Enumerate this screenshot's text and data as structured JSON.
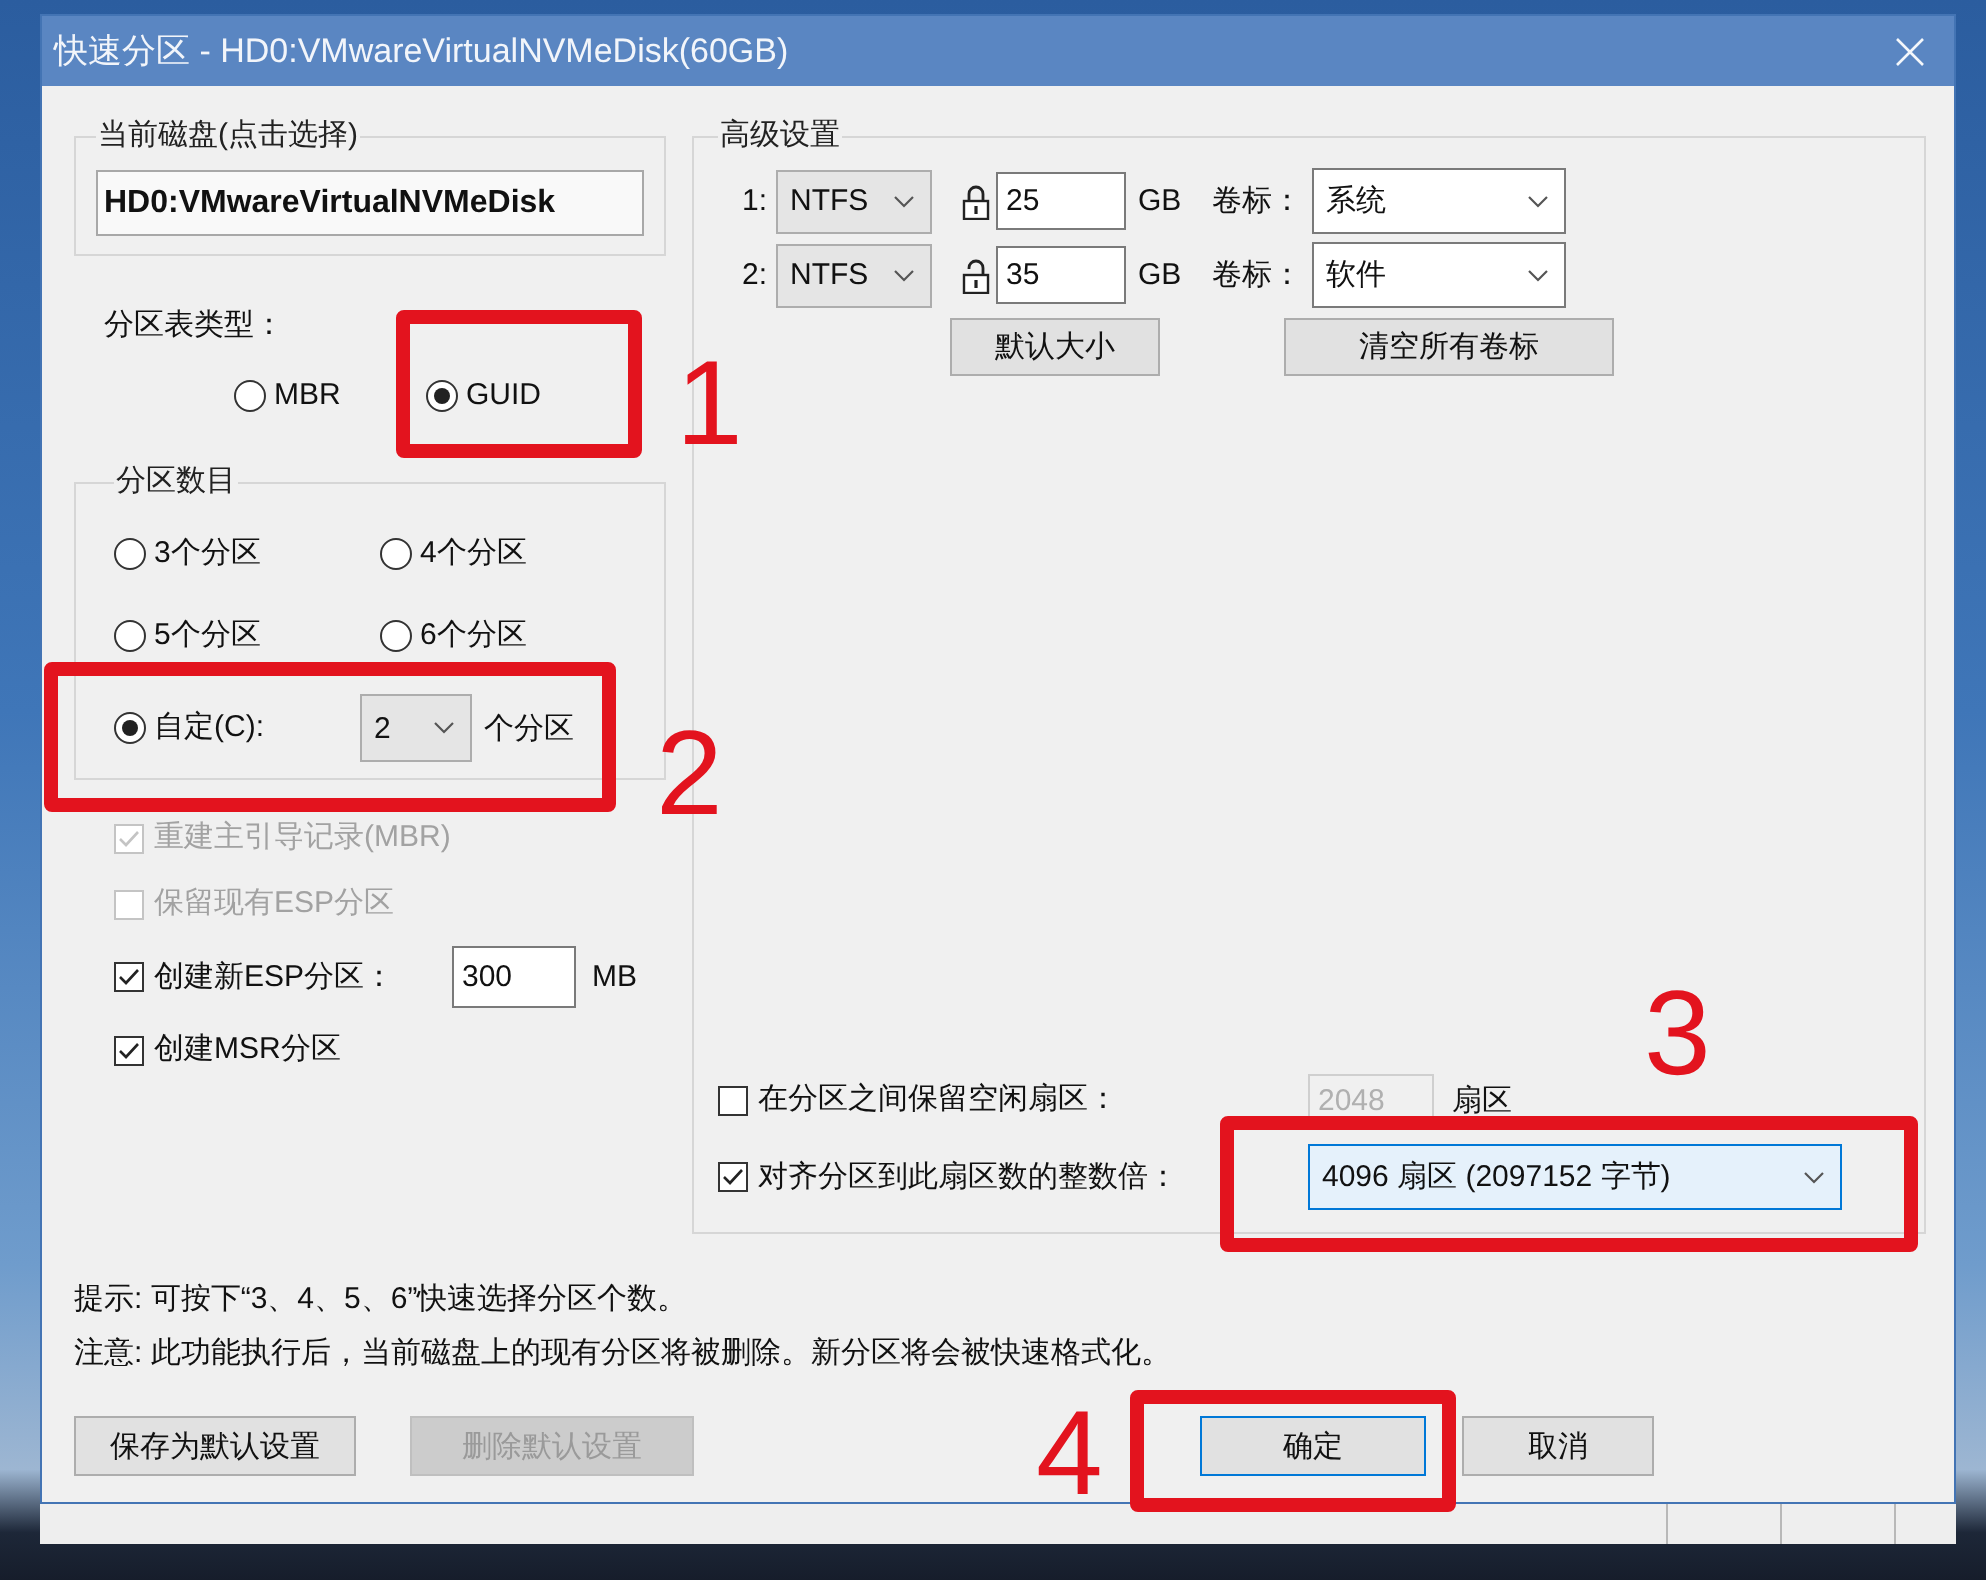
{
  "window": {
    "title": "快速分区 - HD0:VMwareVirtualNVMeDisk(60GB)"
  },
  "current_disk": {
    "label": "当前磁盘(点击选择)",
    "value": "HD0:VMwareVirtualNVMeDisk"
  },
  "partition_table": {
    "label": "分区表类型：",
    "options": [
      {
        "label": "MBR",
        "selected": false
      },
      {
        "label": "GUID",
        "selected": true
      }
    ]
  },
  "partition_count": {
    "label": "分区数目",
    "options": [
      {
        "kind": "radio",
        "label": "3个分区",
        "selected": false
      },
      {
        "kind": "radio",
        "label": "4个分区",
        "selected": false
      },
      {
        "kind": "radio",
        "label": "5个分区",
        "selected": false
      },
      {
        "kind": "radio",
        "label": "6个分区",
        "selected": false
      },
      {
        "kind": "radio_with_dropdown",
        "label": "自定(C):",
        "selected": true,
        "value": "2",
        "suffix": "个分区"
      }
    ]
  },
  "options": [
    {
      "kind": "checkbox",
      "label": "重建主引导记录(MBR)",
      "checked": true,
      "disabled": true
    },
    {
      "kind": "checkbox",
      "label": "保留现有ESP分区",
      "checked": false,
      "disabled": true
    },
    {
      "kind": "checkbox_with_field",
      "label": "创建新ESP分区：",
      "checked": true,
      "disabled": false,
      "value": "300",
      "unit": "MB"
    },
    {
      "kind": "checkbox",
      "label": "创建MSR分区",
      "checked": true,
      "disabled": false
    }
  ],
  "advanced": {
    "label": "高级设置",
    "partitions": [
      {
        "index": "1:",
        "filesystem": "NTFS",
        "locked": true,
        "size": "25",
        "unit": "GB",
        "volume_label_caption": "卷标：",
        "volume_label": "系统"
      },
      {
        "index": "2:",
        "filesystem": "NTFS",
        "locked": false,
        "size": "35",
        "unit": "GB",
        "volume_label_caption": "卷标：",
        "volume_label": "软件"
      }
    ],
    "buttons": [
      {
        "label": "默认大小"
      },
      {
        "label": "清空所有卷标"
      }
    ],
    "reserve_gap": {
      "label": "在分区之间保留空闲扇区：",
      "checked": false,
      "value": "2048",
      "unit": "扇区",
      "disabled": true
    },
    "align": {
      "label": "对齐分区到此扇区数的整数倍：",
      "checked": true,
      "value": "4096 扇区 (2097152 字节)",
      "highlighted": true
    }
  },
  "notes": [
    "提示: 可按下“3、4、5、6”快速选择分区个数。",
    "注意: 此功能执行后，当前磁盘上的现有分区将被删除。新分区将会被快速格式化。"
  ],
  "buttons": [
    {
      "label": "保存为默认设置",
      "disabled": false,
      "focused": false
    },
    {
      "label": "删除默认设置",
      "disabled": true,
      "focused": false
    },
    {
      "label": "确定",
      "disabled": false,
      "focused": true
    },
    {
      "label": "取消",
      "disabled": false,
      "focused": false
    }
  ],
  "annotations": [
    {
      "number": "1"
    },
    {
      "number": "2"
    },
    {
      "number": "3"
    },
    {
      "number": "4"
    }
  ]
}
